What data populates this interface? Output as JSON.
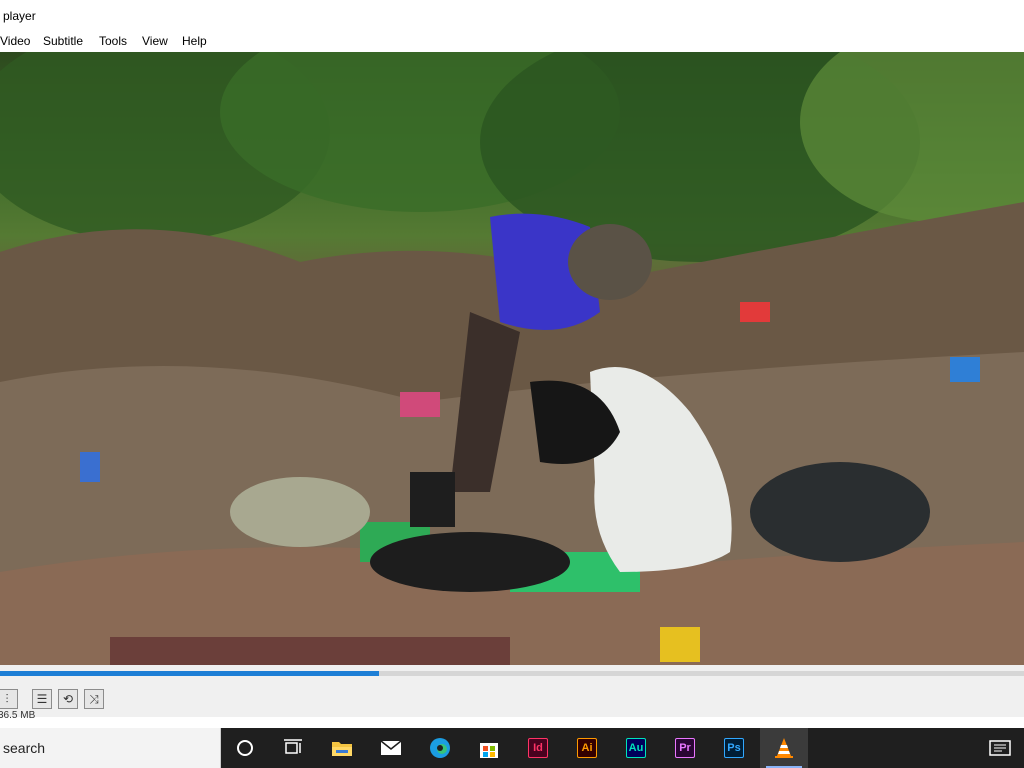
{
  "window": {
    "title": "player"
  },
  "menu": {
    "items": [
      "Video",
      "Subtitle",
      "Tools",
      "View",
      "Help"
    ]
  },
  "playback": {
    "progress_percent": 37
  },
  "status": {
    "size_text": "36.5 MB"
  },
  "taskbar": {
    "search_text": "search",
    "apps": [
      {
        "name": "Id",
        "color": "#ff3366",
        "bg": "#49021f"
      },
      {
        "name": "Ai",
        "color": "#ff9a00",
        "bg": "#330000"
      },
      {
        "name": "Au",
        "color": "#00e4bb",
        "bg": "#00005b"
      },
      {
        "name": "Pr",
        "color": "#ea77ff",
        "bg": "#2a0634"
      },
      {
        "name": "Ps",
        "color": "#31a8ff",
        "bg": "#001e36"
      }
    ]
  },
  "colors": {
    "accent": "#1e7fd6"
  }
}
